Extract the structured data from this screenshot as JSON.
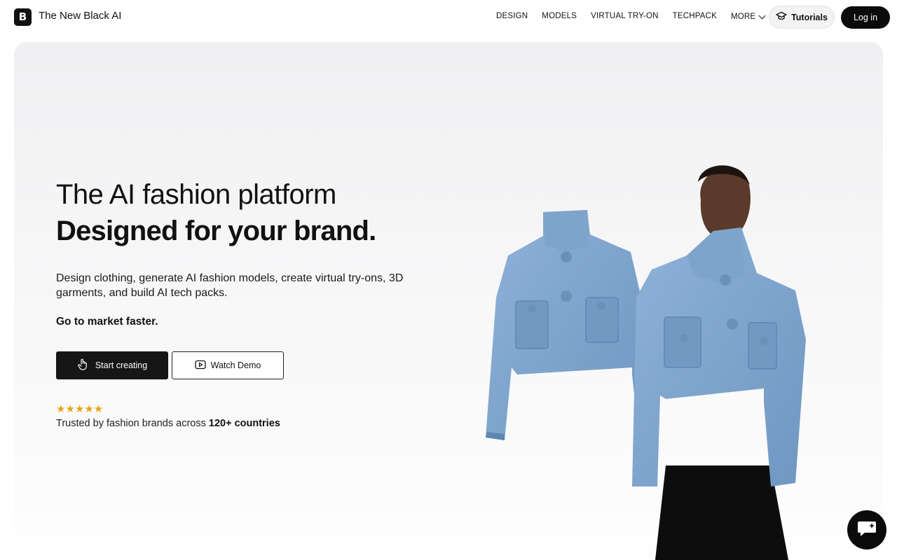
{
  "brand": {
    "name": "The New Black AI",
    "logo_letter": "B"
  },
  "nav": {
    "links": [
      "DESIGN",
      "MODELS",
      "VIRTUAL TRY-ON",
      "TECHPACK"
    ],
    "more_label": "MORE",
    "tutorials_label": "Tutorials",
    "login_label": "Log in"
  },
  "hero": {
    "title_light": "The AI fashion platform",
    "title_bold": "Designed for your brand.",
    "description": "Design clothing, generate AI fashion models, create virtual try-ons, 3D garments, and build AI tech packs.",
    "tagline": "Go to market faster.",
    "start_label": "Start creating",
    "demo_label": "Watch Demo",
    "stars": "★★★★★",
    "trusted_prefix": "Trusted by fashion brands across",
    "trusted_highlight": "120+ countries"
  },
  "colors": {
    "accent": "#0b0b0b",
    "star": "#e8a317",
    "jacket": "#7ea3cc"
  },
  "icons": [
    "hand-pointer-icon",
    "play-icon",
    "graduation-cap-icon",
    "chevron-down-icon",
    "chat-icon"
  ]
}
